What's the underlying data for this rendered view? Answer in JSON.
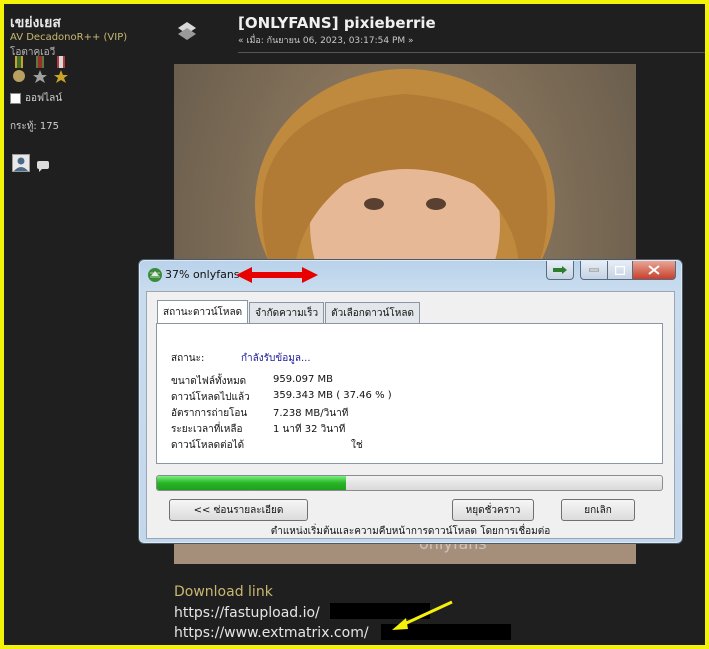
{
  "user": {
    "name": "เขย่งเยส",
    "group": "AV DecadonoR++ (VIP)",
    "status": "โอตาคุเอวี",
    "online": "ออฟไลน์",
    "posts": "กระทู้: 175"
  },
  "post": {
    "title": "[ONLYFANS] pixieberrie",
    "date": "« เมื่อ: กันยายน 06, 2023, 03:17:54 PM »"
  },
  "photo": {
    "watermark": "onlyfans"
  },
  "download": {
    "label": "Download link",
    "link1": "https://fastupload.io/",
    "link2": "https://www.extmatrix.com/"
  },
  "dialog": {
    "title": "37% onlyfans",
    "tabs": [
      {
        "label": "สถานะดาวน์โหลด",
        "active": true
      },
      {
        "label": "จำกัดความเร็ว",
        "active": false
      },
      {
        "label": "ตัวเลือกดาวน์โหลด",
        "active": false
      }
    ],
    "status_label": "สถานะ:",
    "status_value": "กำลังรับข้อมูล...",
    "rows": [
      {
        "label": "ขนาดไฟล์ทั้งหมด",
        "value": "959.097  MB"
      },
      {
        "label": "ดาวน์โหลดไปแล้ว",
        "value": "359.343  MB  ( 37.46 % )"
      },
      {
        "label": "อัตราการถ่ายโอน",
        "value": "7.238  MB/วินาที"
      },
      {
        "label": "ระยะเวลาที่เหลือ",
        "value": "1 นาที 32 วินาที"
      },
      {
        "label": "ดาวน์โหลดต่อได้",
        "value": "ใช่"
      }
    ],
    "progress": 0.3746,
    "buttons": {
      "hide": "<< ซ่อนรายละเอียด",
      "pause": "หยุดชั่วคราว",
      "cancel": "ยกเลิก"
    },
    "footer": "ตำแหน่งเริ่มต้นและความคืบหน้าการดาวน์โหลด โดยการเชื่อมต่อ"
  },
  "colors": {
    "border_yellow": "#f5f20a",
    "forum_bg": "#1f1f1f",
    "link_gold": "#c9b870",
    "progress_green": "#27b527",
    "annotation_red": "#e80000"
  }
}
